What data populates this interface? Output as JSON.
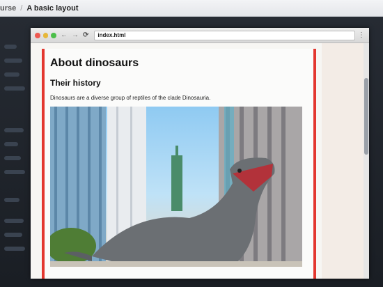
{
  "course_bar": {
    "prev_crumb": "urse",
    "separator": "/",
    "current_crumb": "A basic layout"
  },
  "browser": {
    "address": "index.html",
    "back_icon": "back-arrow-icon",
    "forward_icon": "forward-arrow-icon",
    "reload_icon": "reload-icon",
    "colors": {
      "close": "#ee5a52",
      "minimize": "#e6b73a",
      "maximize": "#4cbf4a",
      "border_accent": "#e3372f"
    }
  },
  "page": {
    "title": "About dinosaurs",
    "subtitle": "Their history",
    "text": "Dinosaurs are a diverse group of reptiles of the clade Dinosauria."
  }
}
